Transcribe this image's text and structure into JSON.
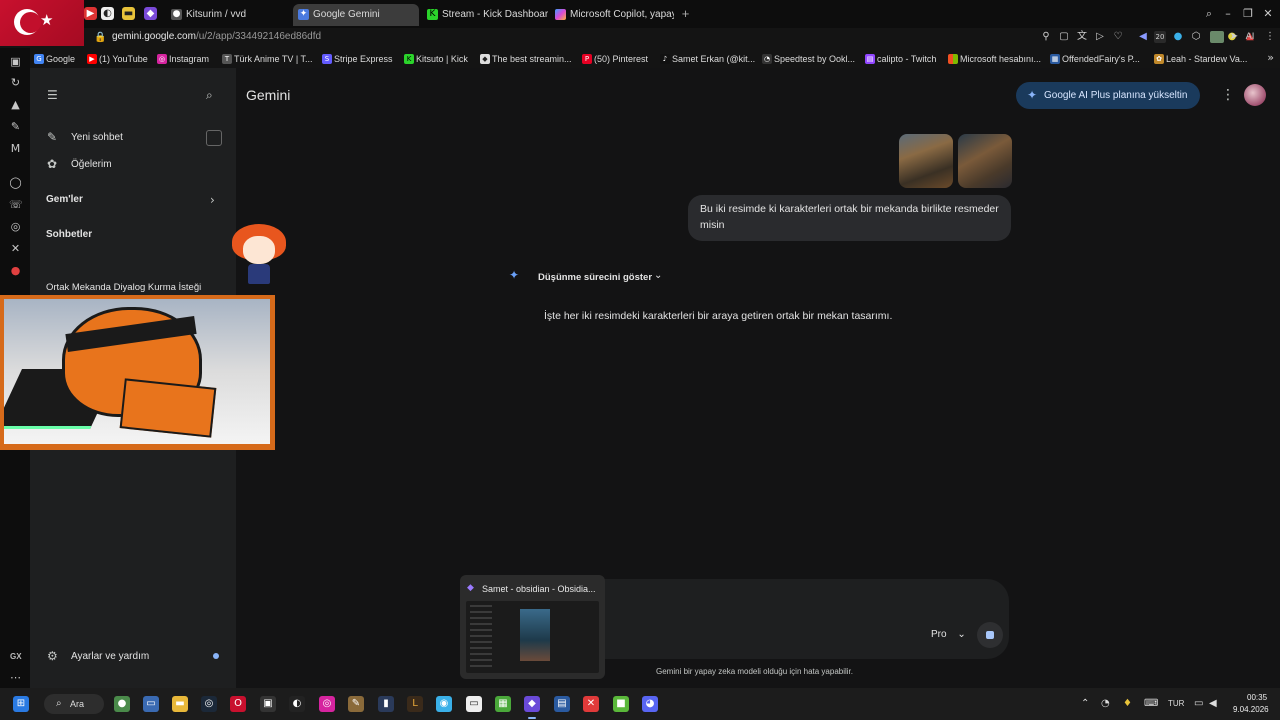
{
  "browser": {
    "tabs": [
      {
        "label": "Kitsurim / vvd",
        "active": false
      },
      {
        "label": "Google Gemini",
        "active": true
      },
      {
        "label": "Stream - Kick Dashboard",
        "active": false
      },
      {
        "label": "Microsoft Copilot, yapay z",
        "active": false
      }
    ],
    "new_tab_glyph": "+",
    "url_host": "gemini.google.com",
    "url_path": "/u/2/app/334492146ed86dfd",
    "extension_badge": "20",
    "ai_label": "AI"
  },
  "bookmarks": [
    {
      "label": "Google",
      "icon": "google-icon",
      "color": "#4285f4"
    },
    {
      "label": "(1) YouTube",
      "icon": "youtube-icon",
      "color": "#ff0000"
    },
    {
      "label": "Instagram",
      "icon": "instagram-icon",
      "color": "#d6249f"
    },
    {
      "label": "Türk Anime TV | T...",
      "icon": "anime-icon",
      "color": "#555555"
    },
    {
      "label": "Stripe Express",
      "icon": "stripe-icon",
      "color": "#635bff"
    },
    {
      "label": "Kitsuto | Kick",
      "icon": "kick-icon",
      "color": "#53fc18"
    },
    {
      "label": "The best streamin...",
      "icon": "stream-icon",
      "color": "#dddddd"
    },
    {
      "label": "(50) Pinterest",
      "icon": "pinterest-icon",
      "color": "#e60023"
    },
    {
      "label": "Samet Erkan (@kit...",
      "icon": "tiktok-icon",
      "color": "#111111"
    },
    {
      "label": "Speedtest by Ookl...",
      "icon": "speedtest-icon",
      "color": "#333333"
    },
    {
      "label": "calipto - Twitch",
      "icon": "twitch-icon",
      "color": "#9146ff"
    },
    {
      "label": "Microsoft hesabını...",
      "icon": "microsoft-icon",
      "color": "#f25022"
    },
    {
      "label": "OffendedFairy's P...",
      "icon": "profile-icon",
      "color": "#2a5aa0"
    },
    {
      "label": "Leah - Stardew Va...",
      "icon": "stardew-icon",
      "color": "#c0882a"
    }
  ],
  "sidebar": {
    "new_chat": "Yeni sohbet",
    "my_items": "Öğelerim",
    "gems": "Gem'ler",
    "chats_header": "Sohbetler",
    "recent_chat": "Ortak Mekanda Diyalog Kurma İsteği",
    "settings": "Ayarlar ve yardım",
    "gx_label": "GX"
  },
  "header": {
    "title": "Gemini",
    "upgrade_label": "Google AI Plus planına yükseltin"
  },
  "conversation": {
    "user_message": "Bu iki resimde ki karakterleri ortak bir mekanda birlikte resmeder misin",
    "thinking_toggle": "Düşünme sürecini göster",
    "response_text": "İşte her iki resimdeki karakterleri bir araya getiren ortak bir mekan tasarımı."
  },
  "composer": {
    "model_label": "Pro",
    "disclaimer": "Gemini bir yapay zeka modeli olduğu için hata yapabilir."
  },
  "taskbar_preview": {
    "title": "Samet - obsidian - Obsidia..."
  },
  "taskbar": {
    "search_label": "Ara",
    "language": "TUR",
    "time": "00:35",
    "date": "9.04.2026"
  },
  "colors": {
    "accent": "#8ab4f8",
    "upgrade_bg": "#1a3a5c",
    "webcam_frame": "#d66a1a"
  }
}
